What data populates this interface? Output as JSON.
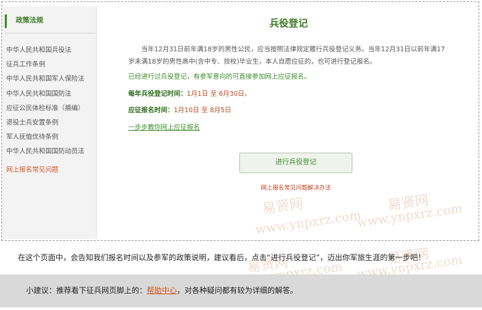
{
  "sidebar": {
    "title": "政策法规",
    "items": [
      {
        "label": "中华人民共和国兵役法"
      },
      {
        "label": "征兵工作条例"
      },
      {
        "label": "中华人民共和国军人保险法"
      },
      {
        "label": "中华人民共和国国防法"
      },
      {
        "label": "应征公民体检标准（摘编）"
      },
      {
        "label": "退役士兵安置条例"
      },
      {
        "label": "军人抚恤优待条例"
      },
      {
        "label": "中华人民共和国国防动员法"
      }
    ],
    "faq_link": "网上报名常见问题"
  },
  "main": {
    "title": "兵役登记",
    "paragraph": "当年12月31日前年满18岁的男性公民，应当按照法律规定履行兵役登记义务。当年12月31日以前年满17岁未满18岁的男性高中(含中专、技校)毕业生，本人自愿应征的，也可进行登记报名。",
    "registered_note": "已经进行过兵役登记，有参军意向的可直接参加网上应征报名。",
    "registration_time_label": "每年兵役登记时间：",
    "registration_time_value": "1月1日 至 6月30日。",
    "application_time_label": "应征报名时间：",
    "application_time_value": "1月10日 至 8月5日",
    "guide_link": "一步步教你网上应征报名",
    "register_button": "进行兵役登记",
    "faq_solution_link": "网上报名常见问题解决办法"
  },
  "watermark": {
    "cn": "易贤网",
    "url": "www.ynpxrz.com"
  },
  "notice": "在这个页面中，会告知我们报名时间以及参军的政策说明，建议看后，点击“进行兵役登记”，迈出你军旅生涯的第一步吧！",
  "tip": {
    "prefix": "小建议：推荐看下征兵网页脚上的：",
    "link": "帮助中心",
    "suffix": "，对各种疑问都有较为详细的解答。"
  },
  "colors": {
    "accent_green": "#3b7a23",
    "link_orange": "#d2521e",
    "date_red": "#b84a1f"
  }
}
